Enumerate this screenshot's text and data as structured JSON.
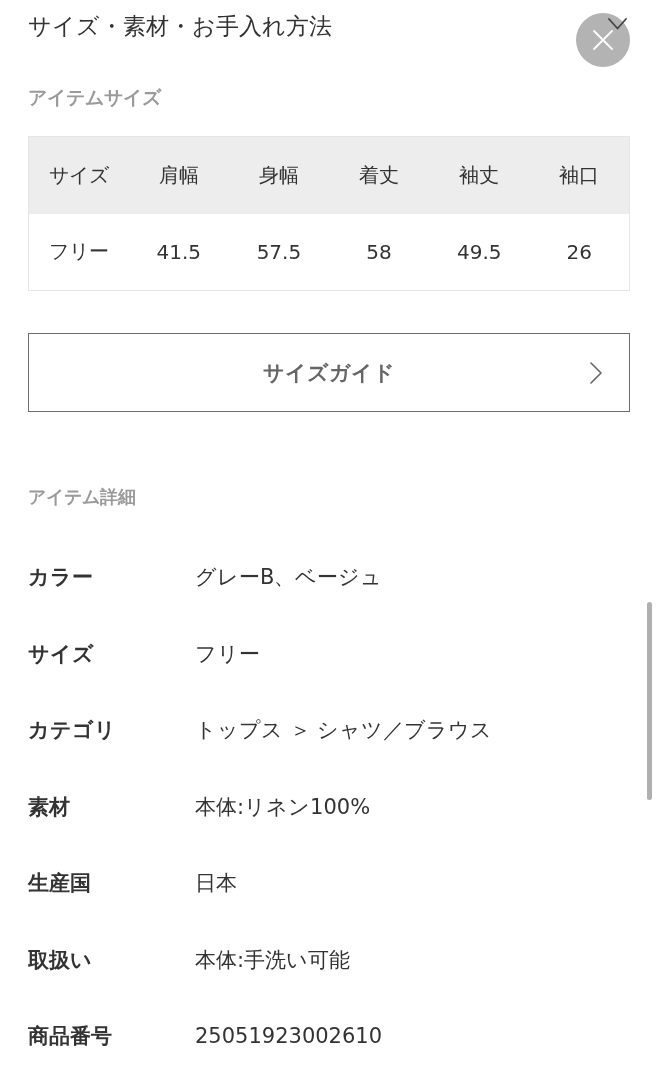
{
  "header": {
    "title": "サイズ・素材・お手入れ方法"
  },
  "size_section": {
    "heading": "アイテムサイズ",
    "table": {
      "columns": [
        "サイズ",
        "肩幅",
        "身幅",
        "着丈",
        "袖丈",
        "袖口"
      ],
      "rows": [
        [
          "フリー",
          "41.5",
          "57.5",
          "58",
          "49.5",
          "26"
        ]
      ]
    }
  },
  "size_guide_button": {
    "label": "サイズガイド"
  },
  "details_section": {
    "heading": "アイテム詳細",
    "rows": [
      {
        "label": "カラー",
        "value": "グレーB、ベージュ"
      },
      {
        "label": "サイズ",
        "value": "フリー"
      },
      {
        "label": "カテゴリ",
        "value": "トップス ＞ シャツ／ブラウス"
      },
      {
        "label": "素材",
        "value": "本体:リネン100%"
      },
      {
        "label": "生産国",
        "value": "日本"
      },
      {
        "label": "取扱い",
        "value": "本体:手洗い可能"
      },
      {
        "label": "商品番号",
        "value": "25051923002610"
      }
    ]
  }
}
